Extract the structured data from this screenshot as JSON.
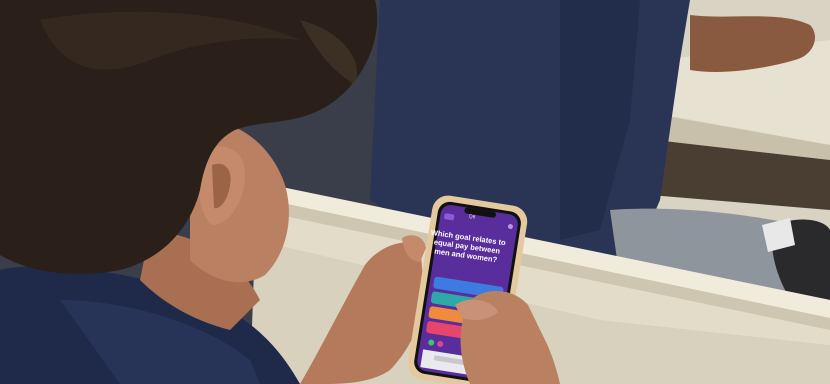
{
  "scene": {
    "phone_screen": {
      "label": "Q6",
      "question": "Which goal relates to equal pay between men and women?",
      "answer_colors": [
        "#3e7be0",
        "#2fa8a8",
        "#f08a3c",
        "#e8456c"
      ],
      "background_color": "#5a2d9c"
    },
    "colors": {
      "wall_shelf": "#e3dcc9",
      "uniform": "#2a3556",
      "skin": "#b98062",
      "hair": "#2a2019",
      "phone_case": "#e5c99e"
    }
  }
}
